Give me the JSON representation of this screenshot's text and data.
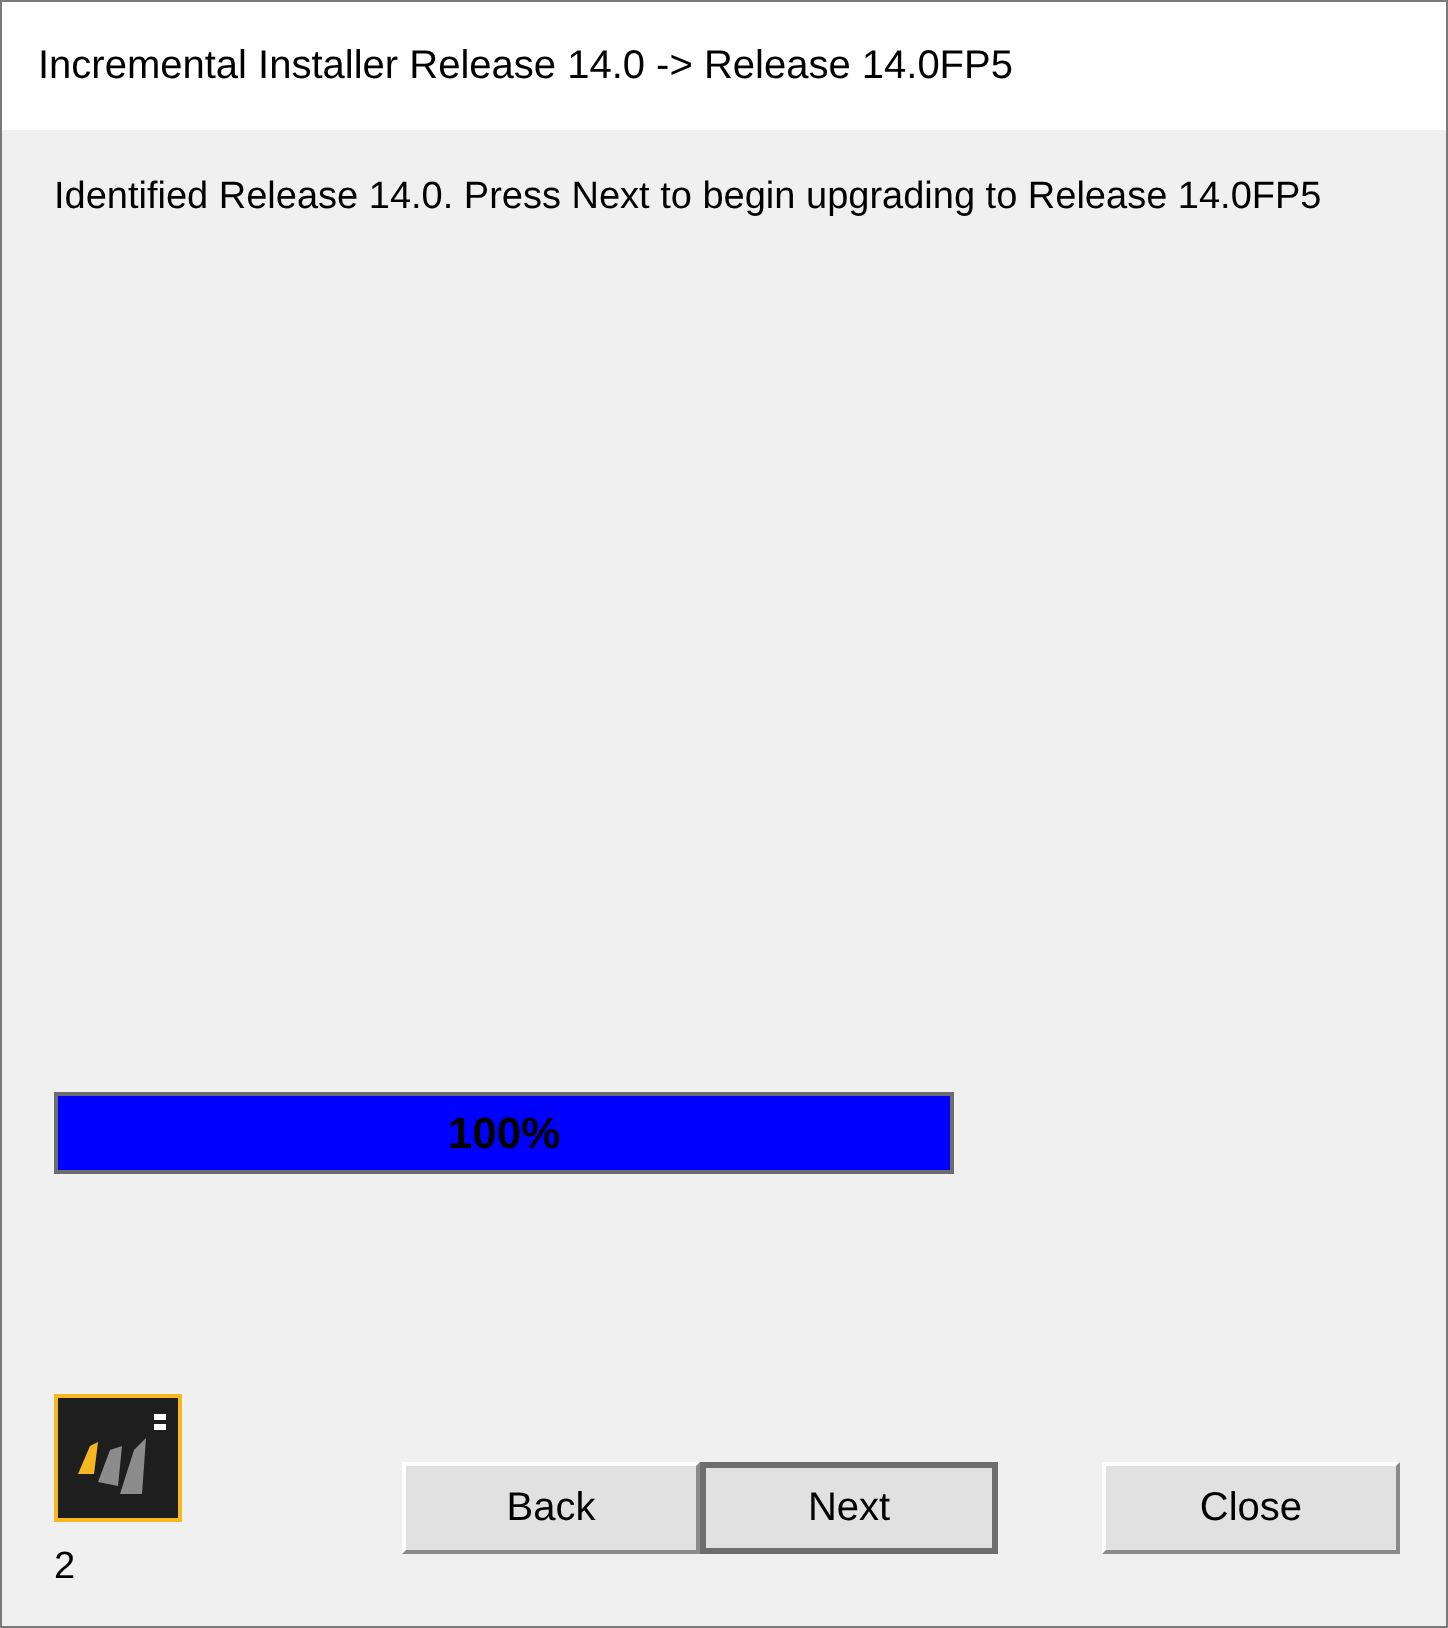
{
  "window": {
    "title": "Incremental Installer Release 14.0 -> Release 14.0FP5"
  },
  "message": "Identified Release 14.0. Press Next to begin upgrading to Release 14.0FP5",
  "progress": {
    "level": 1,
    "reading": "100%"
  },
  "badge": {
    "count": "2"
  },
  "nav_buttons": [
    {
      "label": "Back",
      "default": false
    },
    {
      "label": "Next",
      "default": true
    }
  ],
  "close_button": {
    "label": "Close",
    "default": false
  }
}
